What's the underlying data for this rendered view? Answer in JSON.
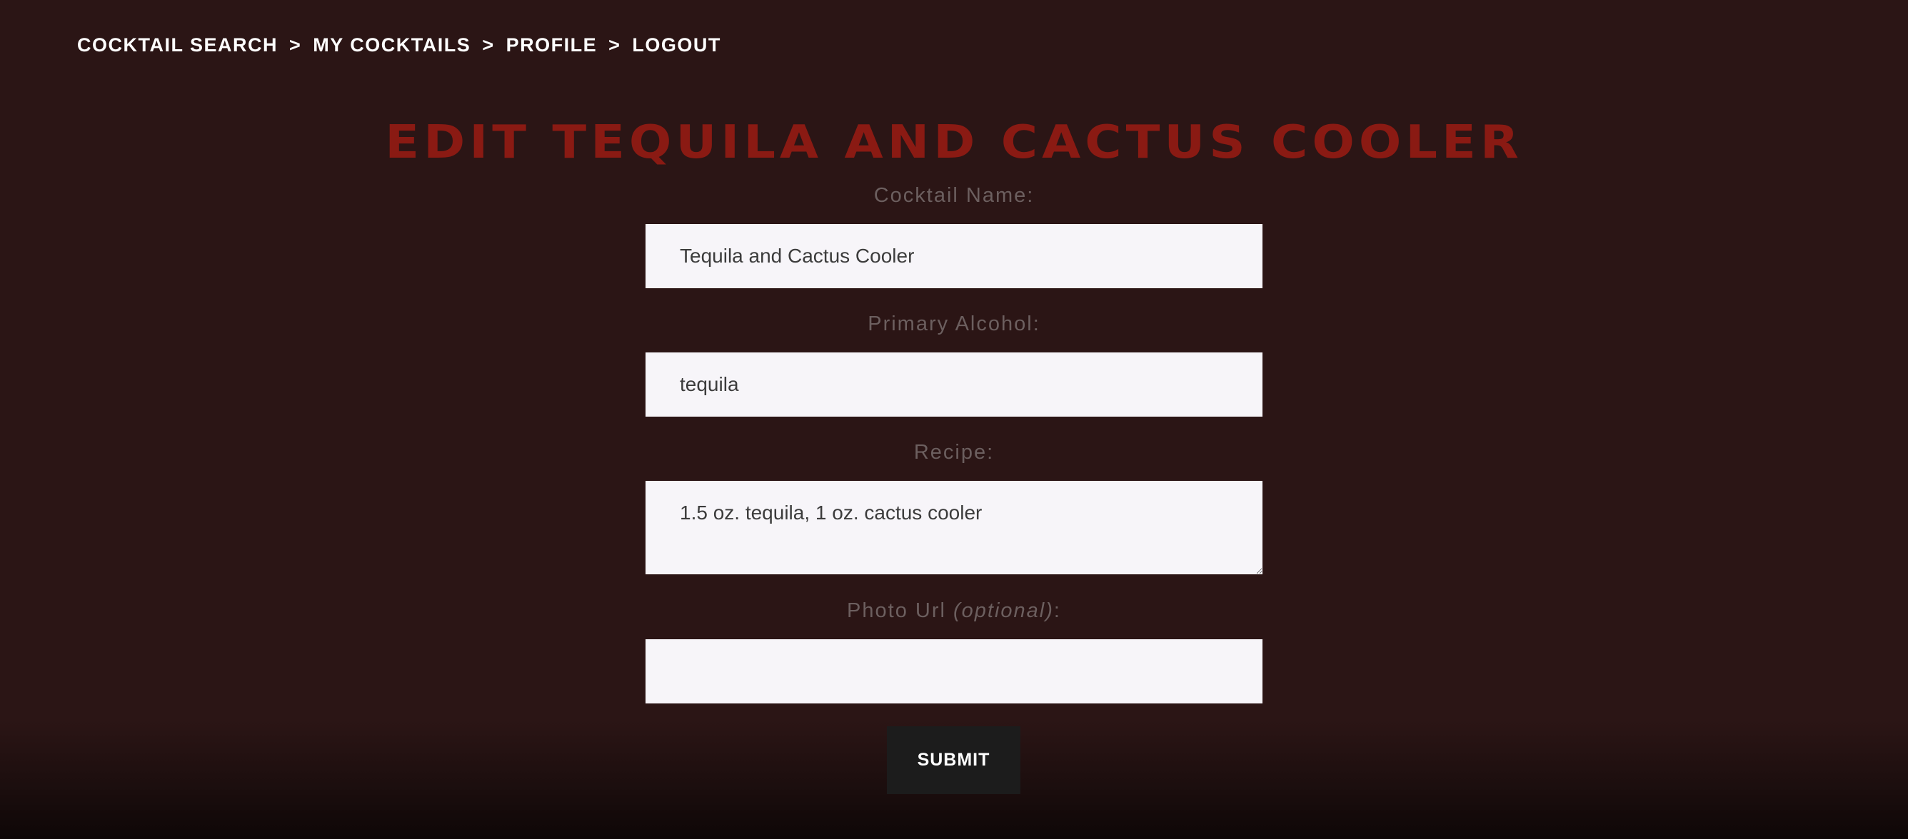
{
  "nav": {
    "items": [
      {
        "label": "COCKTAIL SEARCH"
      },
      {
        "label": "MY COCKTAILS"
      },
      {
        "label": "PROFILE"
      },
      {
        "label": "LOGOUT"
      }
    ],
    "separator": ">"
  },
  "page": {
    "title": "Edit Tequila and Cactus Cooler"
  },
  "form": {
    "name_label": "Cocktail Name:",
    "name_value": "Tequila and Cactus Cooler",
    "alcohol_label": "Primary Alcohol:",
    "alcohol_value": "tequila",
    "recipe_label": "Recipe:",
    "recipe_value": "1.5 oz. tequila, 1 oz. cactus cooler",
    "photo_label_prefix": "Photo Url ",
    "photo_label_optional": "(optional)",
    "photo_label_suffix": ":",
    "photo_value": "",
    "submit_label": "SUBMIT"
  }
}
